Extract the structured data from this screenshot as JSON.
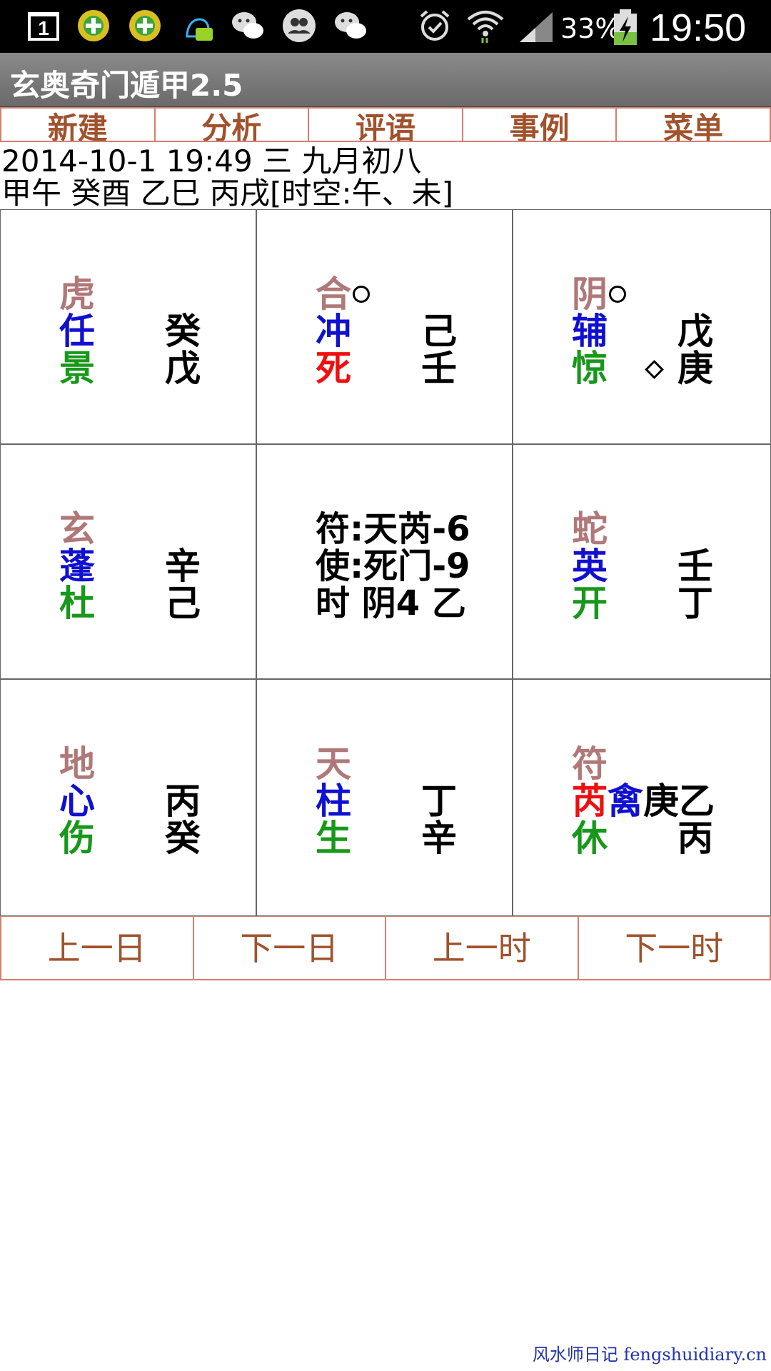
{
  "status_bar": {
    "notification_count": "1",
    "battery_percent": "33%",
    "time": "19:50"
  },
  "app": {
    "title": "玄奥奇门遁甲2.5"
  },
  "menu": [
    "新建",
    "分析",
    "评语",
    "事例",
    "菜单"
  ],
  "info": {
    "line1": "2014-10-1 19:49 三 九月初八",
    "line2": "甲午 癸酉 乙巳 丙戌[时空:午、未]"
  },
  "palaces": {
    "top_left": {
      "god": "虎",
      "star": "任",
      "door": "景",
      "stem_upper": "癸",
      "stem_lower": "戊"
    },
    "top_center": {
      "god": "合",
      "star": "冲",
      "door": "死",
      "stem_upper": "己",
      "stem_lower": "壬"
    },
    "top_right": {
      "god": "阴",
      "star": "辅",
      "door": "惊",
      "stem_upper": "戊",
      "stem_lower": "庚"
    },
    "mid_left": {
      "god": "玄",
      "star": "蓬",
      "door": "杜",
      "stem_upper": "辛",
      "stem_lower": "己"
    },
    "center": {
      "line1": "符:天芮-6",
      "line2": "使:死门-9",
      "line3": "时 阴4 乙"
    },
    "mid_right": {
      "god": "蛇",
      "star": "英",
      "door": "开",
      "stem_upper": "壬",
      "stem_lower": "丁"
    },
    "bottom_left": {
      "god": "地",
      "star": "心",
      "door": "伤",
      "stem_upper": "丙",
      "stem_lower": "癸"
    },
    "bottom_center": {
      "god": "天",
      "star": "柱",
      "door": "生",
      "stem_upper": "丁",
      "stem_lower": "辛"
    },
    "bottom_right": {
      "god": "符",
      "star_a": "芮",
      "star_b": "禽",
      "stem_a": "庚",
      "stem_b": "乙",
      "door": "休",
      "stem_lower": "丙"
    }
  },
  "nav": [
    "上一日",
    "下一日",
    "上一时",
    "下一时"
  ],
  "watermark": "风水师日记 fengshuidiary.cn",
  "colors": {
    "accent": "#a0522d",
    "god": "#b07878",
    "star": "#1010d0",
    "door": "#18981a",
    "highlight": "#ee1010"
  }
}
